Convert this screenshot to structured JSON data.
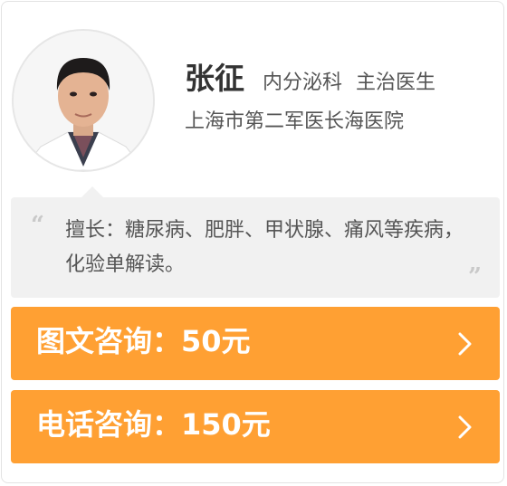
{
  "doctor": {
    "name": "张征",
    "department": "内分泌科",
    "title": "主治医生",
    "hospital": "上海市第二军医长海医院",
    "avatar_icon": "doctor-portrait"
  },
  "specialty": {
    "text": "擅长：糖尿病、肥胖、甲状腺、痛风等疾病，化验单解读。",
    "quote_open": "“",
    "quote_close": "”"
  },
  "actions": {
    "text_consult": "图文咨询：50元",
    "phone_consult": "电话咨询：150元",
    "arrow_icon": "chevron-right-icon"
  },
  "colors": {
    "accent": "#ffa033",
    "panel": "#f1f1f1"
  }
}
